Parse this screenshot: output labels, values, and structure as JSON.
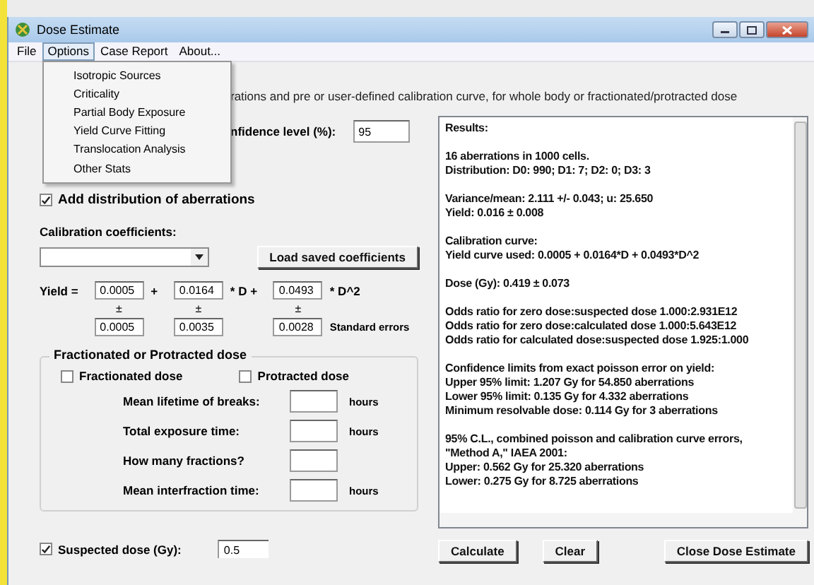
{
  "window": {
    "title": "Dose Estimate"
  },
  "menu": [
    {
      "label": "File",
      "selected": false
    },
    {
      "label": "Options",
      "selected": true
    },
    {
      "label": "Case Report",
      "selected": false
    },
    {
      "label": "About...",
      "selected": false
    }
  ],
  "dropdown": {
    "items": [
      "Isotropic Sources",
      "Criticality",
      "Partial Body Exposure",
      "Yield Curve Fitting",
      "Translocation Analysis",
      "Other Stats"
    ]
  },
  "description": "rations and pre or user-defined calibration curve, for whole body or fractionated/protracted dose",
  "confidence": {
    "label": "nfidence level (%):",
    "value": "95"
  },
  "add_distribution": {
    "label": "Add distribution of aberrations",
    "checked": true
  },
  "calibration": {
    "label": "Calibration coefficients:",
    "load_button": "Load saved coefficients",
    "yield_label": "Yield =",
    "errors_label": "Standard errors",
    "terms": [
      {
        "value": "0.0005",
        "operator": "+",
        "pm": "±",
        "error": "0.0005"
      },
      {
        "value": "0.0164",
        "operator": "* D +",
        "pm": "±",
        "error": "0.0035"
      },
      {
        "value": "0.0493",
        "operator": "* D^2",
        "pm": "±",
        "error": "0.0028"
      }
    ]
  },
  "fractionation": {
    "title": "Fractionated or Protracted dose",
    "options": [
      {
        "label": "Fractionated dose",
        "checked": false
      },
      {
        "label": "Protracted dose",
        "checked": false
      }
    ],
    "fields": [
      {
        "label": "Mean lifetime of breaks:",
        "unit": "hours"
      },
      {
        "label": "Total exposure time:",
        "unit": "hours"
      },
      {
        "label": "How many fractions?"
      },
      {
        "label": "Mean interfraction time:",
        "unit": "hours"
      }
    ]
  },
  "suspected_dose": {
    "label": "Suspected dose (Gy):",
    "checked": true,
    "value": "0.5"
  },
  "results": {
    "title": "Results:",
    "paragraphs": [
      [
        "16 aberrations in 1000 cells.",
        "Distribution: D0: 990; D1: 7; D2: 0; D3: 3"
      ],
      [
        "Variance/mean: 2.111 +/- 0.043; u: 25.650",
        "Yield: 0.016 ± 0.008"
      ],
      [
        "Calibration curve:",
        "Yield curve used: 0.0005 + 0.0164*D + 0.0493*D^2"
      ],
      [
        "Dose (Gy): 0.419 ± 0.073"
      ],
      [
        "Odds ratio for zero dose:suspected dose 1.000:2.931E12",
        "Odds ratio for zero dose:calculated dose 1.000:5.643E12",
        "Odds ratio for calculated dose:suspected dose 1.925:1.000"
      ],
      [
        "Confidence limits from exact poisson error on yield:",
        "Upper 95% limit: 1.207 Gy for 54.850 aberrations",
        "Lower 95% limit: 0.135 Gy for 4.332 aberrations",
        "Minimum resolvable dose: 0.114 Gy for 3 aberrations"
      ],
      [
        "95% C.L., combined poisson and calibration curve errors,",
        "\"Method A,\" IAEA 2001:",
        "Upper: 0.562 Gy for 25.320 aberrations",
        "Lower: 0.275 Gy for 8.725 aberrations"
      ]
    ]
  },
  "buttons": [
    "Calculate",
    "Clear",
    "Close Dose Estimate"
  ]
}
